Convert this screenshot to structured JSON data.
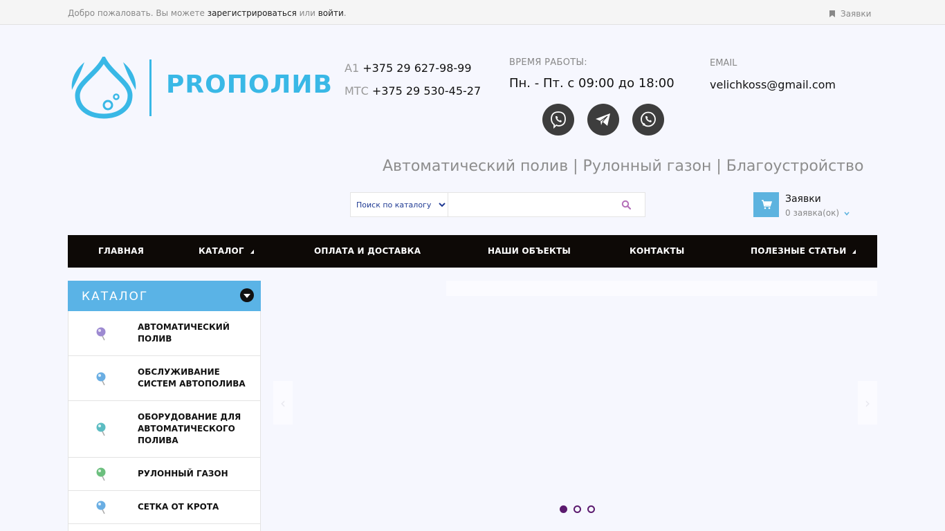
{
  "topbar": {
    "welcome_prefix": "Добро пожаловать. Вы можете",
    "register_link": "зарегистрироваться",
    "or": "или",
    "login_link": "войти",
    "period": ".",
    "orders_link": "Заявки"
  },
  "logo": {
    "text": "PROПОЛИВ"
  },
  "contacts": {
    "phones": [
      {
        "operator": "A1",
        "number": "+375 29 627-98-99"
      },
      {
        "operator": "МТС",
        "number": "+375 29 530-45-27"
      }
    ],
    "hours_label": "Время работы:",
    "hours_value": "Пн. - Пт. с 09:00 до 18:00",
    "email_label": "EMAIL",
    "email_value": "velichkoss@gmail.com",
    "social_icons": [
      "viber-icon",
      "telegram-icon",
      "whatsapp-icon"
    ]
  },
  "tagline": "Автоматический полив | Рулонный газон | Благоустройство",
  "search": {
    "category_options": [
      "Поиск по каталогу"
    ],
    "selected_category": "Поиск по каталогу",
    "query": "",
    "placeholder": ""
  },
  "cart": {
    "title": "Заявки",
    "count_text": "0 заявка(ок)"
  },
  "nav": {
    "items": [
      {
        "label": "ГЛАВНАЯ",
        "dropdown": false
      },
      {
        "label": "КАТАЛОГ",
        "dropdown": true
      },
      {
        "label": "ОПЛАТА И ДОСТАВКА",
        "dropdown": false
      },
      {
        "label": "НАШИ ОБЪЕКТЫ",
        "dropdown": false
      },
      {
        "label": "КОНТАКТЫ",
        "dropdown": false
      },
      {
        "label": "ПОЛЕЗНЫЕ СТАТЬИ",
        "dropdown": true
      }
    ]
  },
  "catalog": {
    "title": "КАТАЛОГ",
    "items": [
      {
        "label": "АВТОМАТИЧЕСКИЙ ПОЛИВ",
        "icon_color": "#9d8ad1"
      },
      {
        "label": "ОБСЛУЖИВАНИЕ СИСТЕМ АВТОПОЛИВА",
        "icon_color": "#6aaee3"
      },
      {
        "label": "ОБОРУДОВАНИЕ ДЛЯ АВТОМАТИЧЕСКОГО ПОЛИВА",
        "icon_color": "#5cbcc2"
      },
      {
        "label": "РУЛОННЫЙ ГАЗОН",
        "icon_color": "#6cbf7e"
      },
      {
        "label": "СЕТКА ОТ КРОТА",
        "icon_color": "#6aaee3"
      }
    ]
  },
  "slider": {
    "slide_count": 3,
    "active_slide": 1
  },
  "colors": {
    "brand_blue": "#39b8e6",
    "nav_bg": "#0d0906",
    "catalog_head": "#5ab3e6",
    "slider_dot": "#5b1a6e"
  }
}
